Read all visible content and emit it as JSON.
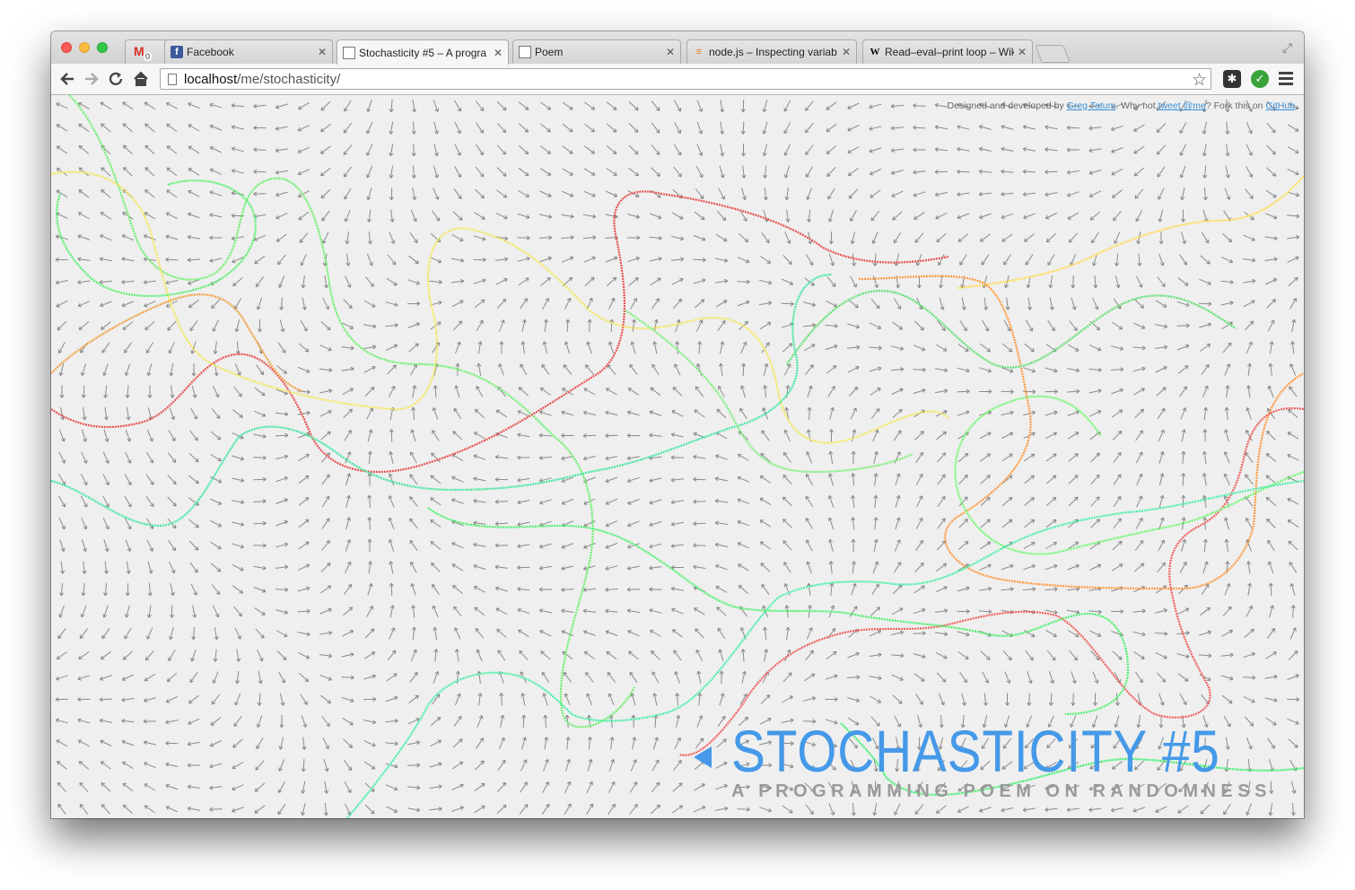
{
  "browser": {
    "gmail_count": "0",
    "tabs": [
      {
        "title": "Facebook",
        "favicon": "facebook-icon"
      },
      {
        "title": "Stochasticity #5 – A progra",
        "favicon": "document-icon",
        "active": true
      },
      {
        "title": "Poem",
        "favicon": "document-icon"
      },
      {
        "title": "node.js – Inspecting variab",
        "favicon": "stackoverflow-icon"
      },
      {
        "title": "Read–eval–print loop – Wik",
        "favicon": "wikipedia-icon"
      }
    ],
    "url_host": "localhost",
    "url_path": "/me/stochasticity/"
  },
  "page": {
    "credits": {
      "prefix": "Designed and developed by ",
      "author_link": "Greg Tatum",
      "middle": ". Why not ",
      "tweet_link": "tweet @me",
      "suffix": "? Fork this on ",
      "github_link": "GitHub",
      "end": "."
    },
    "title": "STOCHASTICITY #5",
    "subtitle": "A PROGRAMMING POEM ON RANDOMNESS",
    "colors": {
      "accent": "#4599e8",
      "background": "#efefef",
      "arrow": "#8a8a8a",
      "subtitle": "#9a9a9a"
    }
  }
}
